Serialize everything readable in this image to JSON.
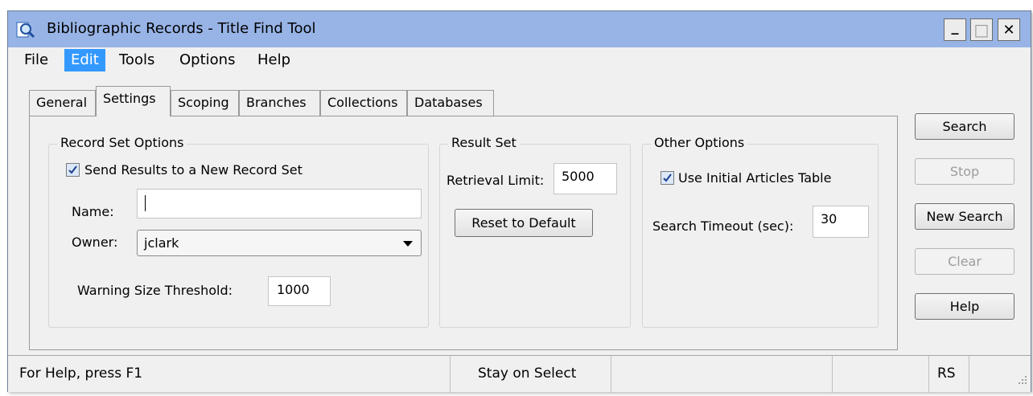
{
  "window": {
    "title": "Bibliographic Records - Title Find Tool",
    "controls": {
      "minimize": "_",
      "maximize": "□",
      "close": "✕"
    }
  },
  "menu": [
    "File",
    "Edit",
    "Tools",
    "Options",
    "Help"
  ],
  "tabs": [
    "General",
    "Settings",
    "Scoping",
    "Branches",
    "Collections",
    "Databases"
  ],
  "record_set_options": {
    "title": "Record Set Options",
    "send_results_label": "Send Results to a New Record Set",
    "send_results_checked": true,
    "name_label": "Name:",
    "name_value": "",
    "owner_label": "Owner:",
    "owner_value": "jclark",
    "warning_label": "Warning Size Threshold:",
    "warning_value": "1000"
  },
  "result_set": {
    "title": "Result Set",
    "retrieval_label": "Retrieval Limit:",
    "retrieval_value": "5000",
    "reset_label": "Reset to Default"
  },
  "other_options": {
    "title": "Other Options",
    "initial_articles_label": "Use Initial Articles Table",
    "initial_articles_checked": true,
    "timeout_label": "Search Timeout (sec):",
    "timeout_value": "30"
  },
  "buttons": {
    "search": "Search",
    "stop": "Stop",
    "new_search": "New Search",
    "clear": "Clear",
    "help": "Help"
  },
  "status": {
    "help_text": "For Help, press F1",
    "mode": "Stay on Select",
    "user": "RS"
  }
}
